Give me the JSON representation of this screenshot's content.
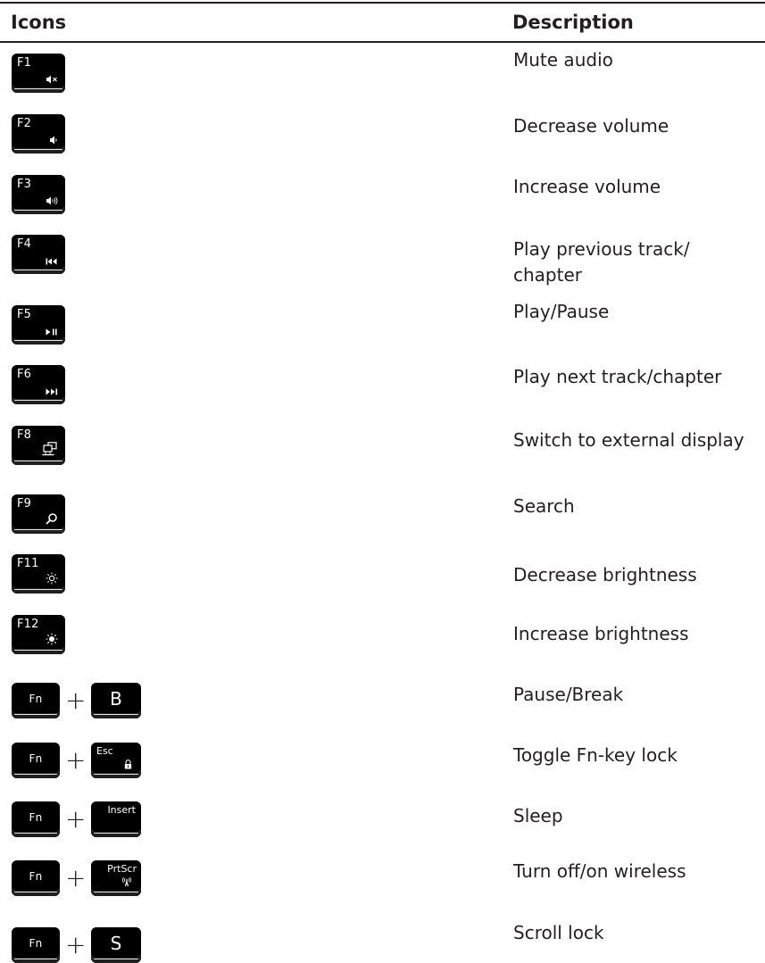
{
  "header": {
    "icons": "Icons",
    "description": "Description"
  },
  "rows": [
    {
      "key": "F1",
      "icon": "mute-icon",
      "description": "Mute audio"
    },
    {
      "key": "F2",
      "icon": "volume-down-icon",
      "description": "Decrease volume"
    },
    {
      "key": "F3",
      "icon": "volume-up-icon",
      "description": "Increase volume"
    },
    {
      "key": "F4",
      "icon": "previous-track-icon",
      "description": "Play previous track/ chapter"
    },
    {
      "key": "F5",
      "icon": "play-pause-icon",
      "description": "Play/Pause"
    },
    {
      "key": "F6",
      "icon": "next-track-icon",
      "description": "Play next track/chapter"
    },
    {
      "key": "F8",
      "icon": "external-display-icon",
      "description": "Switch to external display"
    },
    {
      "key": "F9",
      "icon": "search-icon",
      "description": "Search"
    },
    {
      "key": "F11",
      "icon": "brightness-down-icon",
      "description": "Decrease brightness"
    },
    {
      "key": "F12",
      "icon": "brightness-up-icon",
      "description": "Increase brightness"
    },
    {
      "key": "Fn",
      "key2": "B",
      "description": "Pause/Break"
    },
    {
      "key": "Fn",
      "key2": "Esc",
      "icon": "lock-icon",
      "description": "Toggle Fn-key lock"
    },
    {
      "key": "Fn",
      "key2": "Insert",
      "description": "Sleep"
    },
    {
      "key": "Fn",
      "key2": "PrtScr",
      "icon": "wireless-icon",
      "description": "Turn off/on wireless"
    },
    {
      "key": "Fn",
      "key2": "S",
      "description": "Scroll lock"
    }
  ],
  "plus_sign": "+"
}
